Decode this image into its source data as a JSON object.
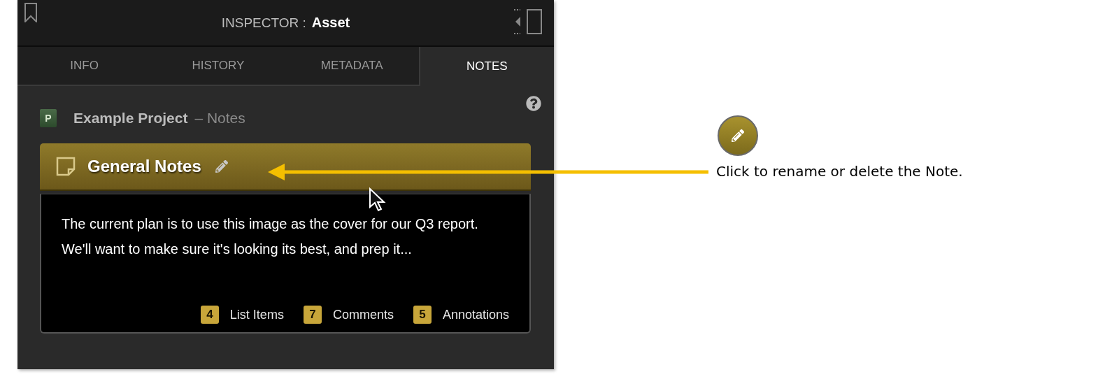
{
  "header": {
    "label": "INSPECTOR :",
    "title": "Asset"
  },
  "tabs": [
    {
      "label": "INFO",
      "selected": false
    },
    {
      "label": "HISTORY",
      "selected": false
    },
    {
      "label": "METADATA",
      "selected": false
    },
    {
      "label": "NOTES",
      "selected": true
    }
  ],
  "project": {
    "icon_letter": "P",
    "name": "Example Project",
    "suffix": "– Notes"
  },
  "note": {
    "title": "General Notes",
    "body": "The current plan is to use this image as the cover for our Q3 report. We'll want to make sure it's looking its best, and prep it...",
    "counts": [
      {
        "value": "4",
        "label": "List Items"
      },
      {
        "value": "7",
        "label": "Comments"
      },
      {
        "value": "5",
        "label": "Annotations"
      }
    ]
  },
  "callout": {
    "text": "Click to rename or delete the Note."
  }
}
